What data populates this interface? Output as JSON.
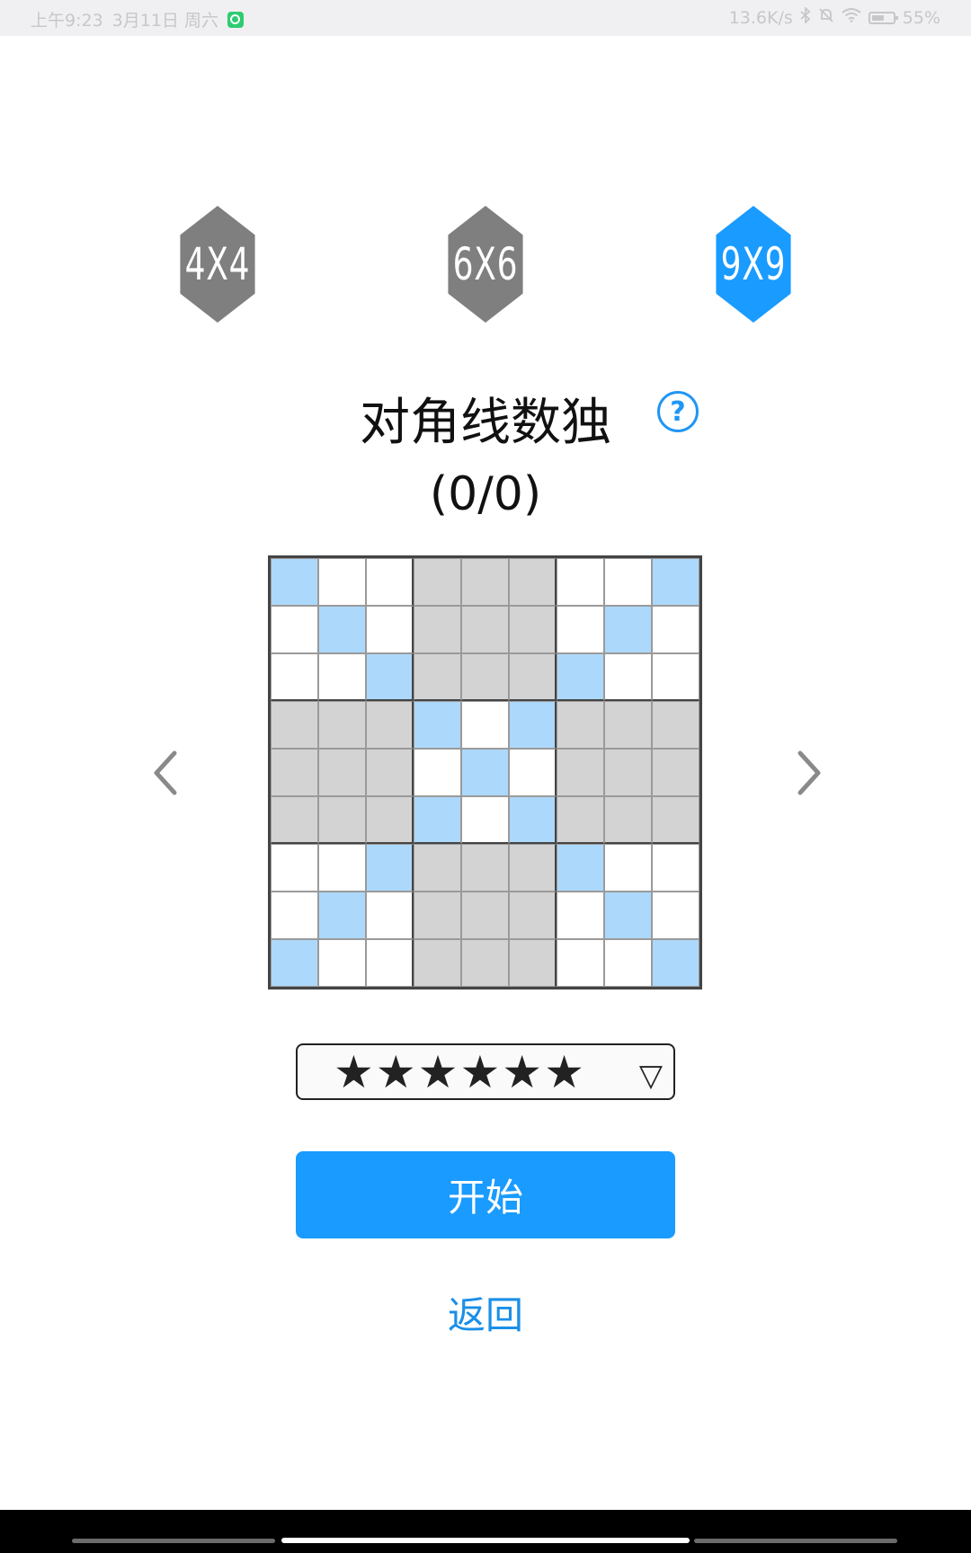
{
  "status_bar": {
    "time": "上午9:23",
    "date": "3月11日 周六",
    "net_speed": "13.6K/s",
    "battery": "55%"
  },
  "sizes": [
    {
      "label": "4X4",
      "selected": false
    },
    {
      "label": "6X6",
      "selected": false
    },
    {
      "label": "9X9",
      "selected": true
    }
  ],
  "colors": {
    "accent": "#1a9bff",
    "inactive": "#7f7f7f",
    "diagonal": "#acd8fb",
    "shaded": "#d3d3d3"
  },
  "puzzle": {
    "title": "对角线数独",
    "help_icon": "?",
    "progress": "(0/0)"
  },
  "grid_preview": [
    "bwwgggwwb",
    "wbwgggwbw",
    "wwbgggbww",
    "gggbwbggg",
    "gggwbwggg",
    "gggbwbggg",
    "wwbgggbww",
    "wbwgggwbw",
    "bwwgggwwb"
  ],
  "difficulty": {
    "stars": "★★★★★★",
    "dropdown_indicator": "▽"
  },
  "actions": {
    "start": "开始",
    "back": "返回"
  }
}
